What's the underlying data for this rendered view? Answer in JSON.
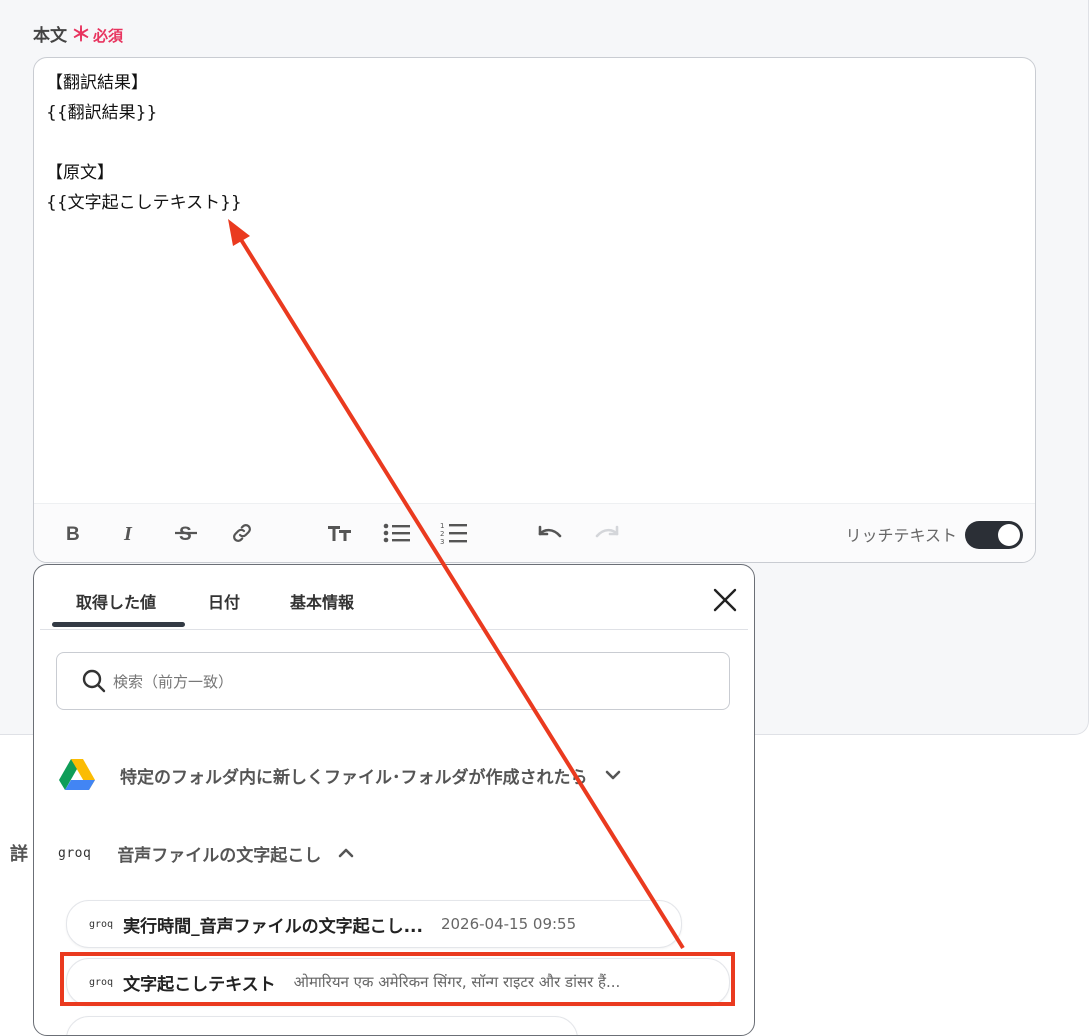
{
  "field": {
    "label": "本文",
    "required_mark": "＊",
    "required_text": "必須"
  },
  "editor": {
    "lines": [
      "【翻訳結果】",
      "{{翻訳結果}}",
      "",
      "【原文】",
      "{{文字起こしテキスト}}"
    ],
    "rich_text_label": "リッチテキスト",
    "rich_text_enabled": true
  },
  "toolbar": {
    "icons": [
      "bold-icon",
      "italic-icon",
      "strikethrough-icon",
      "link-icon",
      "text-size-icon",
      "bullet-list-icon",
      "numbered-list-icon",
      "undo-icon",
      "redo-icon"
    ]
  },
  "popup": {
    "tabs": [
      "取得した値",
      "日付",
      "基本情報"
    ],
    "active_tab": 0,
    "search": {
      "placeholder": "検索（前方一致）",
      "value": ""
    },
    "groups": [
      {
        "title": "特定のフォルダ内に新しくファイル･フォルダが作成されたら",
        "icon": "google-drive-icon",
        "expanded": false
      },
      {
        "title": "音声ファイルの文字起こし",
        "icon": "groq-logo",
        "logo_text": "groq",
        "expanded": true
      }
    ],
    "items": [
      {
        "name": "実行時間_音声ファイルの文字起こし...",
        "value": "2026-04-15 09:55"
      },
      {
        "name": "文字起こしテキスト",
        "value": "ओमारियन एक अमेरिकन सिंगर, सॉन्ग राइटर और डांसर हैं..."
      }
    ]
  },
  "detail_label": "詳",
  "colors": {
    "annotation": "#ea3a1f",
    "required": "#e8345f",
    "toggle_on": "#2b2f36"
  }
}
